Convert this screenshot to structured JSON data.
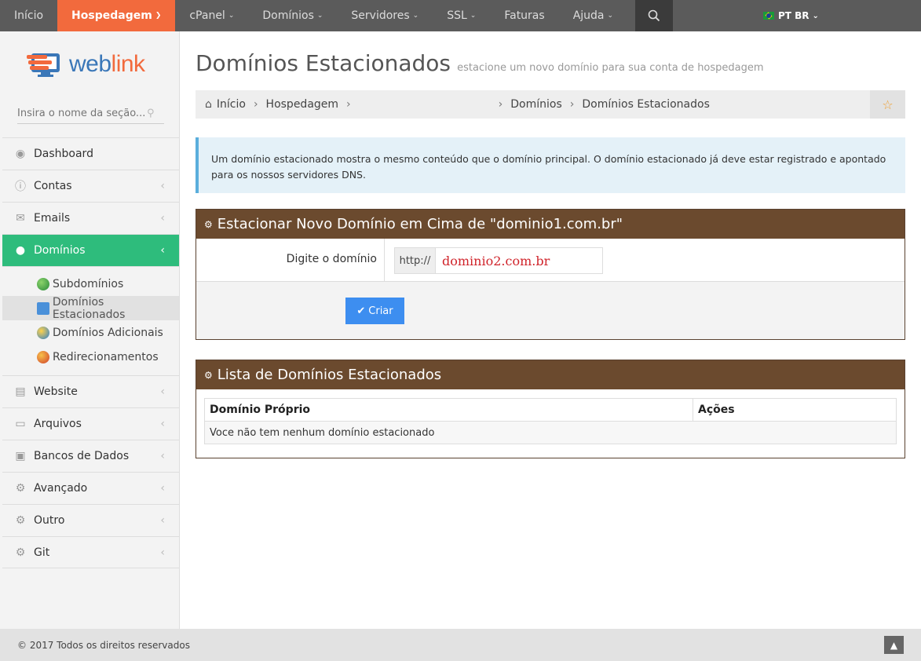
{
  "topnav": {
    "items": [
      {
        "label": "Início",
        "has_caret": false
      },
      {
        "label": "Hospedagem",
        "has_caret": true
      },
      {
        "label": "cPanel",
        "has_caret": true
      },
      {
        "label": "Domínios",
        "has_caret": true
      },
      {
        "label": "Servidores",
        "has_caret": true
      },
      {
        "label": "SSL",
        "has_caret": true
      },
      {
        "label": "Faturas",
        "has_caret": false
      },
      {
        "label": "Ajuda",
        "has_caret": true
      }
    ],
    "active_index": 1,
    "search_icon": "search-icon",
    "language": "PT BR",
    "accent_color": "#f26a3d"
  },
  "sidebar": {
    "logo": {
      "part1": "web",
      "part2": "link"
    },
    "search_placeholder": "Insira o nome da seção...",
    "items": [
      {
        "label": "Dashboard",
        "icon": "dashboard-icon"
      },
      {
        "label": "Contas",
        "icon": "info-icon"
      },
      {
        "label": "Emails",
        "icon": "envelope-icon"
      },
      {
        "label": "Domínios",
        "icon": "globe-icon"
      },
      {
        "label": "Website",
        "icon": "monitor-icon"
      },
      {
        "label": "Arquivos",
        "icon": "folder-icon"
      },
      {
        "label": "Bancos de Dados",
        "icon": "archive-icon"
      },
      {
        "label": "Avançado",
        "icon": "cogs-icon"
      },
      {
        "label": "Outro",
        "icon": "gear-icon"
      },
      {
        "label": "Git",
        "icon": "cogs-icon"
      }
    ],
    "submenu": [
      {
        "label": "Subdomínios"
      },
      {
        "label": "Domínios Estacionados"
      },
      {
        "label": "Domínios Adicionais"
      },
      {
        "label": "Redirecionamentos"
      }
    ],
    "active_color": "#2ebc7c"
  },
  "page": {
    "title": "Domínios Estacionados",
    "subtitle": "estacione um novo domínio para sua conta de hospedagem"
  },
  "breadcrumb": {
    "items": [
      "Início",
      "Hospedagem",
      "Domínios",
      "Domínios Estacionados"
    ]
  },
  "info": {
    "text": "Um domínio estacionado mostra o mesmo conteúdo que o domínio principal. O domínio estacionado já deve estar registrado e apontado para os nossos servidores DNS."
  },
  "park_panel": {
    "title_prefix": "Estacionar Novo Domínio em Cima de \"",
    "domain": "dominio1.com.br",
    "title_suffix": "\"",
    "field_label": "Digite o domínio",
    "prefix": "http://",
    "value": "dominio2.com.br",
    "button": "Criar"
  },
  "list_panel": {
    "title": "Lista de Domínios Estacionados",
    "columns": [
      "Domínio Próprio",
      "Ações"
    ],
    "empty_message": "Voce não tem nenhum domínio estacionado"
  },
  "footer": {
    "copyright": "© 2017 Todos os direitos reservados"
  }
}
